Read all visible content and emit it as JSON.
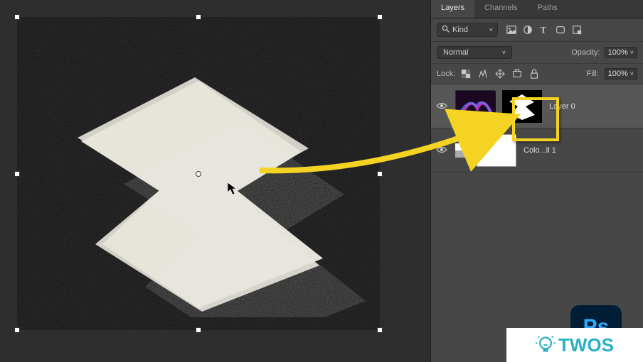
{
  "panel": {
    "tabs": {
      "layers": "Layers",
      "channels": "Channels",
      "paths": "Paths"
    },
    "filter": {
      "kind_icon": "search-icon",
      "kind_label": "Kind",
      "icons": [
        "image-icon",
        "adjustment-icon",
        "type-icon",
        "shape-icon",
        "smart-object-icon"
      ]
    },
    "blend": {
      "mode": "Normal",
      "opacity_label": "Opacity:",
      "opacity_value": "100%"
    },
    "lock": {
      "label": "Lock:",
      "icons": [
        "lock-image-icon",
        "lock-position-icon",
        "lock-brush-icon",
        "lock-artboard-icon",
        "lock-all-icon"
      ],
      "fill_label": "Fill:",
      "fill_value": "100%"
    },
    "layers": [
      {
        "name": "Layer 0",
        "has_mask": true,
        "selected": true
      },
      {
        "name": "Colo...ll 1",
        "type": "fill",
        "has_mask": true,
        "selected": false
      }
    ]
  },
  "badges": {
    "ps": "Ps",
    "twos": "TWOS"
  }
}
